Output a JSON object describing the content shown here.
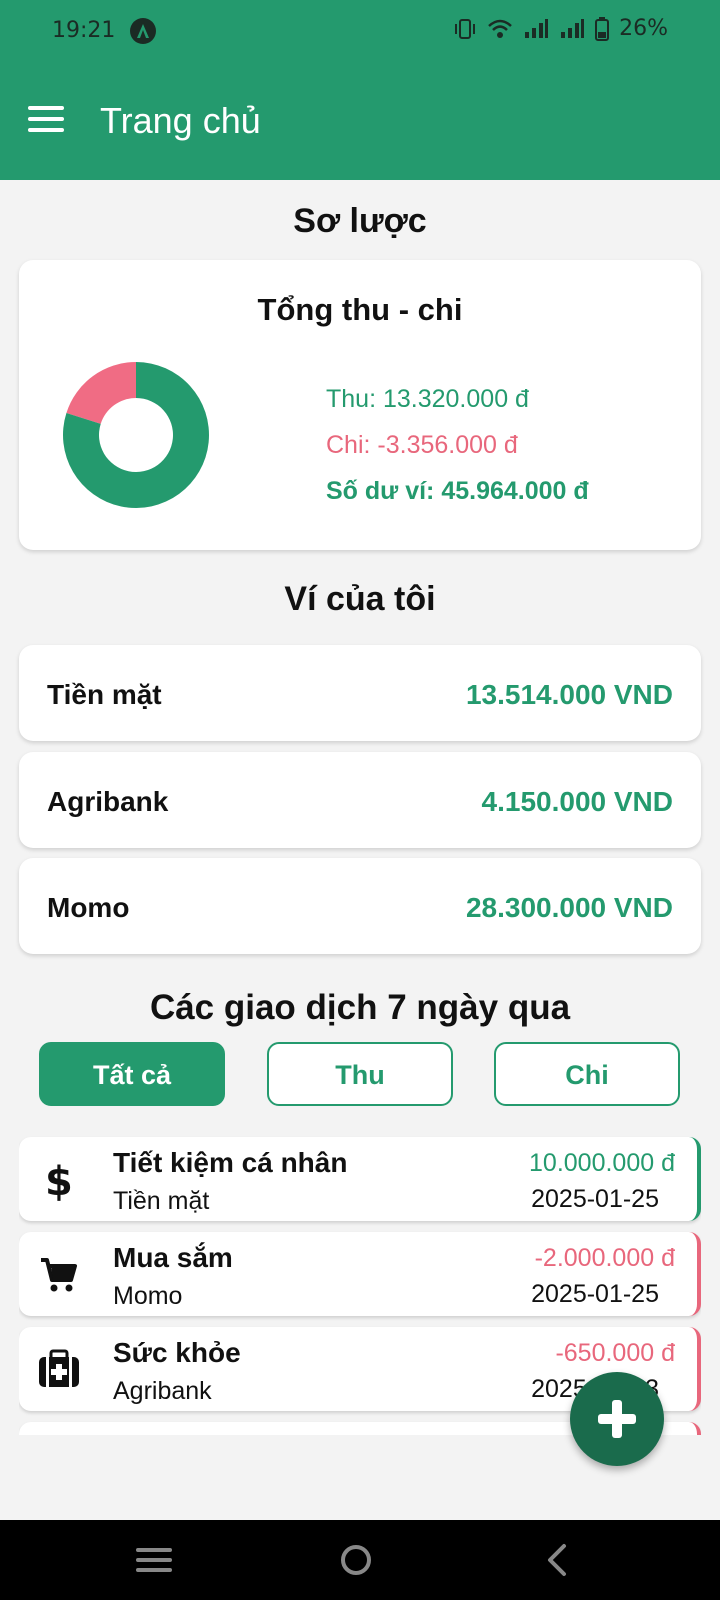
{
  "status_bar": {
    "time": "19:21",
    "battery": "26%"
  },
  "app_bar": {
    "title": "Trang chủ"
  },
  "summary": {
    "section_title": "Sơ lược",
    "card_title": "Tổng thu - chi",
    "income_label": "Thu: 13.320.000 đ",
    "expense_label": "Chi: -3.356.000 đ",
    "balance_label": "Số dư ví: 45.964.000 đ",
    "chart_data": {
      "type": "pie",
      "categories": [
        "Thu",
        "Chi"
      ],
      "values": [
        13320000,
        3356000
      ],
      "colors": [
        "#249a6e",
        "#f06c84"
      ]
    }
  },
  "wallets": {
    "section_title": "Ví của tôi",
    "items": [
      {
        "name": "Tiền mặt",
        "amount": "13.514.000 VND"
      },
      {
        "name": "Agribank",
        "amount": "4.150.000 VND"
      },
      {
        "name": "Momo",
        "amount": "28.300.000 VND"
      }
    ]
  },
  "transactions": {
    "section_title": "Các giao dịch 7 ngày qua",
    "tabs": [
      "Tất cả",
      "Thu",
      "Chi"
    ],
    "items": [
      {
        "icon": "dollar-icon",
        "title": "Tiết kiệm cá nhân",
        "wallet": "Tiền mặt",
        "amount": "10.000.000 đ",
        "date": "2025-01-25",
        "kind": "income"
      },
      {
        "icon": "cart-icon",
        "title": "Mua sắm",
        "wallet": "Momo",
        "amount": "-2.000.000 đ",
        "date": "2025-01-25",
        "kind": "expense"
      },
      {
        "icon": "medical-kit-icon",
        "title": "Sức khỏe",
        "wallet": "Agribank",
        "amount": "-650.000 đ",
        "date": "2025-01-23",
        "kind": "expense"
      }
    ]
  },
  "colors": {
    "primary": "#249a6e",
    "expense": "#e8677c",
    "fab": "#1a6b4c"
  }
}
